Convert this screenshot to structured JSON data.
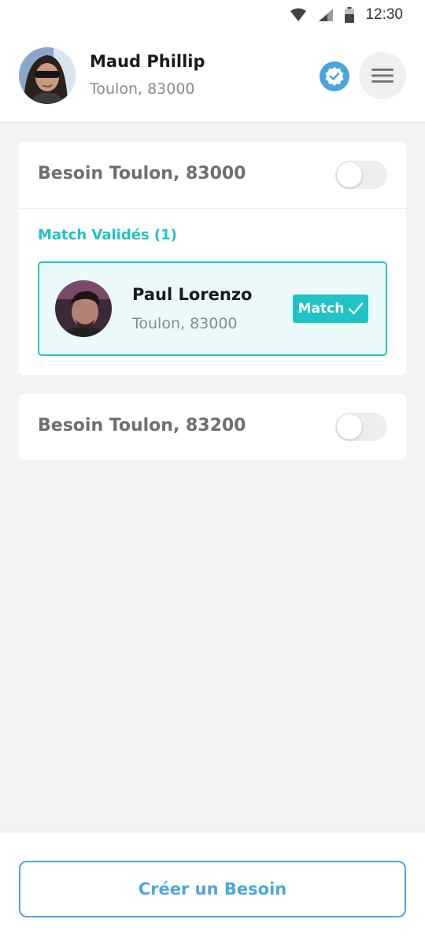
{
  "status_bar": {
    "time": "12:30",
    "icons": [
      "wifi-icon",
      "cell-signal-icon",
      "battery-icon"
    ]
  },
  "header": {
    "name": "Maud Phillip",
    "location": "Toulon, 83000",
    "verified_icon": "verified-badge-icon",
    "menu_icon": "hamburger-menu-icon"
  },
  "besoins": [
    {
      "title": "Besoin Toulon, 83000",
      "enabled": false,
      "section_label": "Match Validés (1)",
      "matches": [
        {
          "name": "Paul Lorenzo",
          "location": "Toulon, 83000",
          "badge": "Match"
        }
      ]
    },
    {
      "title": "Besoin Toulon, 83200",
      "enabled": false
    }
  ],
  "create_button": "Créer un Besoin",
  "colors": {
    "accent_teal": "#1fc3c3",
    "accent_blue": "#4ea6dc",
    "background": "#f3f3f3"
  }
}
